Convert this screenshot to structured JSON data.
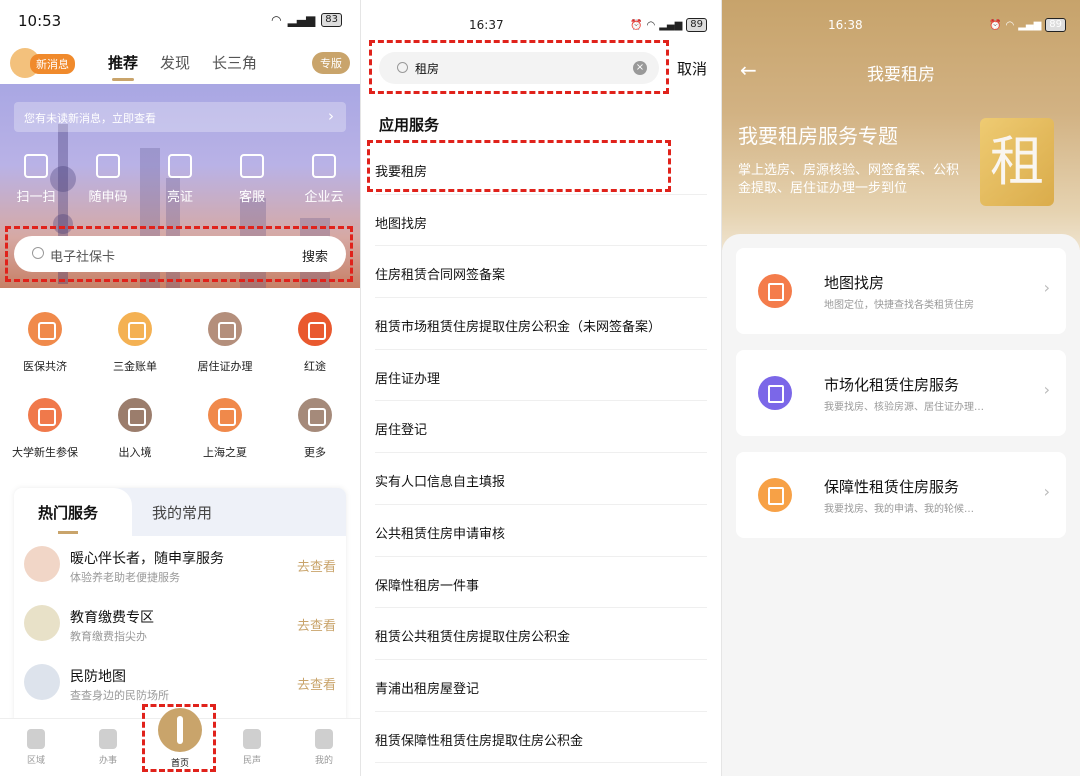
{
  "panel1": {
    "status": {
      "time": "10:53",
      "battery": "83"
    },
    "header": {
      "new_msg": "新消息",
      "tabs": [
        {
          "label": "推荐",
          "active": true
        },
        {
          "label": "发现",
          "active": false
        },
        {
          "label": "长三角",
          "active": false
        }
      ],
      "version": "专版"
    },
    "notice": "您有未读新消息，立即查看",
    "quick": [
      "扫一扫",
      "随申码",
      "亮证",
      "客服",
      "企业云"
    ],
    "search": {
      "placeholder": "电子社保卡",
      "button": "搜索"
    },
    "grid": [
      {
        "label": "医保共济",
        "color": "#f08a4b"
      },
      {
        "label": "三金账单",
        "color": "#f4b153"
      },
      {
        "label": "居住证办理",
        "color": "#b48f7c"
      },
      {
        "label": "红途",
        "color": "#e9592f"
      },
      {
        "label": "大学新生参保",
        "color": "#f0794b"
      },
      {
        "label": "出入境",
        "color": "#9b7d6c"
      },
      {
        "label": "上海之夏",
        "color": "#f0894b"
      },
      {
        "label": "更多",
        "color": "#a58a7a"
      }
    ],
    "hot": {
      "tabs": [
        "热门服务",
        "我的常用"
      ],
      "items": [
        {
          "title": "暖心伴长者，随申享服务",
          "sub": "体验养老助老便捷服务",
          "action": "去查看",
          "color": "#f1d6c7"
        },
        {
          "title": "教育缴费专区",
          "sub": "教育缴费指尖办",
          "action": "去查看",
          "color": "#e8e1c8"
        },
        {
          "title": "民防地图",
          "sub": "查查身边的民防场所",
          "action": "去查看",
          "color": "#dde3ec"
        }
      ]
    },
    "nav": [
      "区域",
      "办事",
      "首页",
      "民声",
      "我的"
    ]
  },
  "panel2": {
    "status": {
      "time": "16:37",
      "battery": "89"
    },
    "search": {
      "value": "租房",
      "cancel": "取消"
    },
    "section": "应用服务",
    "results": [
      "我要租房",
      "地图找房",
      "住房租赁合同网签备案",
      "租赁市场租赁住房提取住房公积金（未网签备案）",
      "居住证办理",
      "居住登记",
      "实有人口信息自主填报",
      "公共租赁住房申请审核",
      "保障性租房一件事",
      "租赁公共租赁住房提取住房公积金",
      "青浦出租房屋登记",
      "租赁保障性租赁住房提取住房公积金"
    ]
  },
  "panel3": {
    "status": {
      "time": "16:38",
      "battery": "89"
    },
    "title": "我要租房",
    "hero_title": "我要租房服务专题",
    "hero_desc": "掌上选房、房源核验、网签备案、公积金提取、居住证办理一步到位",
    "hero_char": "租",
    "cards": [
      {
        "title": "地图找房",
        "sub": "地图定位，快捷查找各类租赁住房",
        "color": "#f47c4b"
      },
      {
        "title": "市场化租赁住房服务",
        "sub": "我要找房、核验房源、居住证办理…",
        "color": "#7b67e8"
      },
      {
        "title": "保障性租赁住房服务",
        "sub": "我要找房、我的申请、我的轮候…",
        "color": "#f7a146"
      }
    ]
  }
}
